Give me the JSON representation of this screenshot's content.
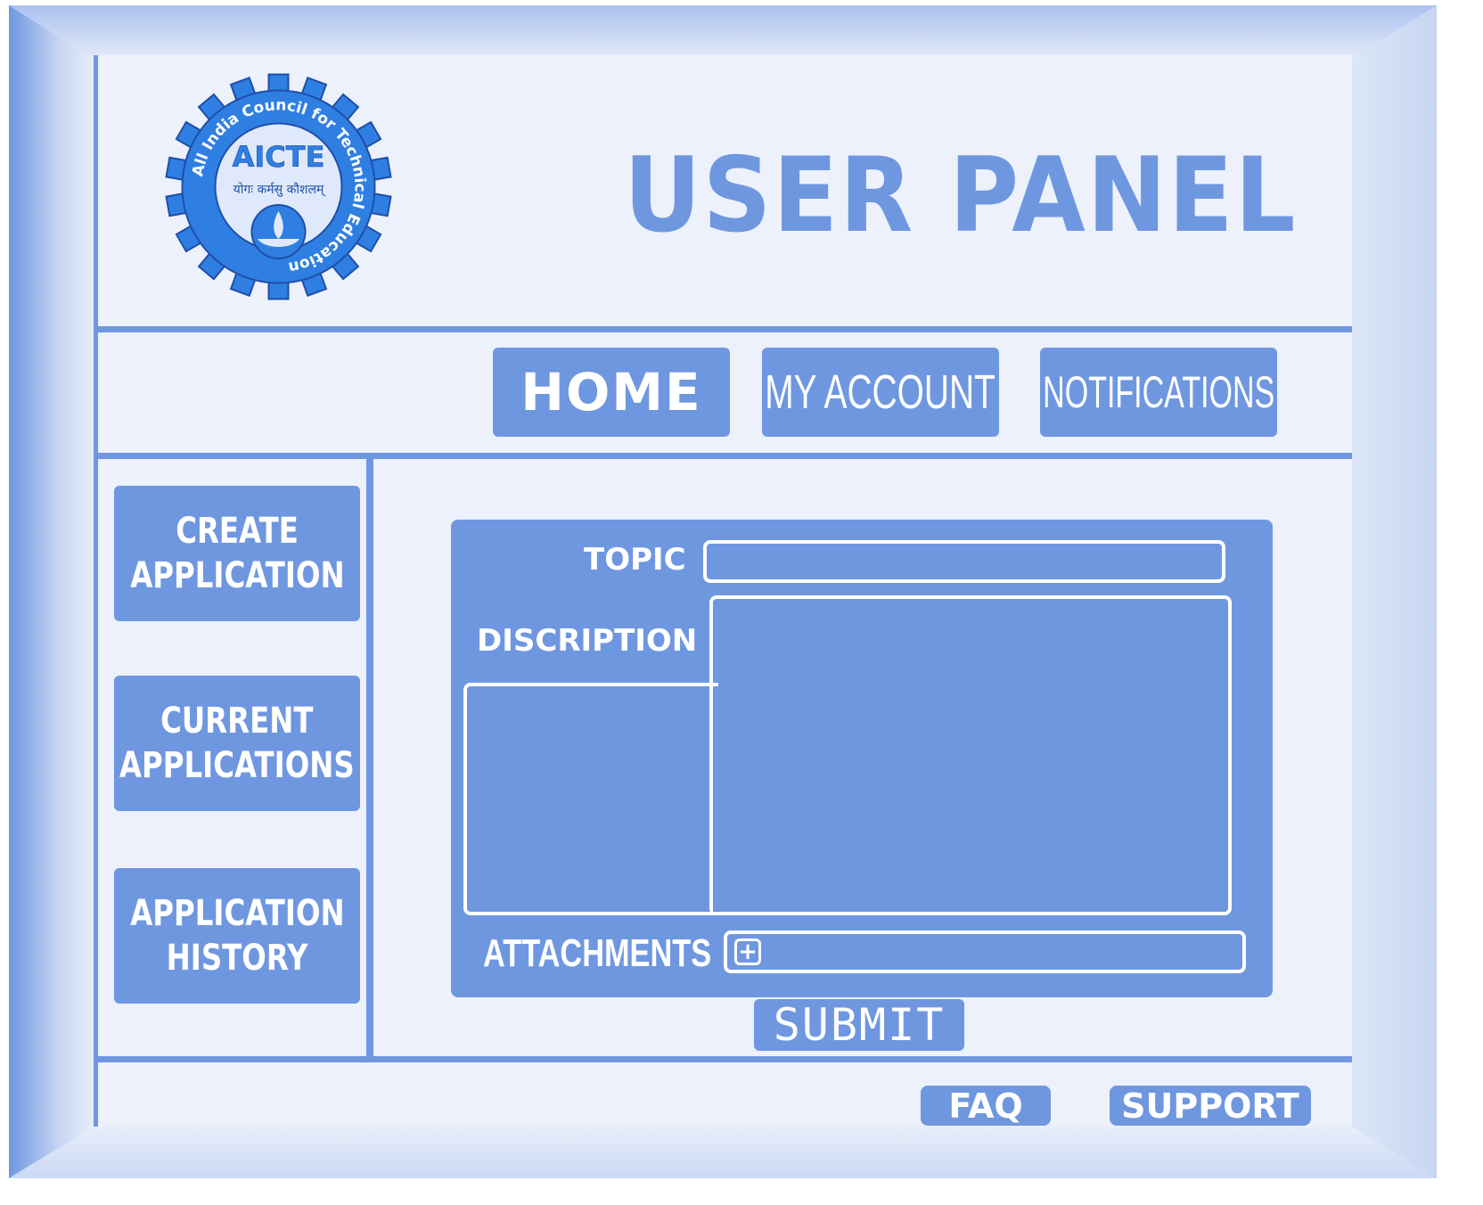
{
  "header": {
    "title": "USER PANEL",
    "logo": {
      "name": "AICTE",
      "ring_text": "All India Council for Technical Education",
      "motto": "योगः कर्मसु कौशलम्",
      "icon": "lamp-icon"
    }
  },
  "nav": {
    "home": "HOME",
    "account": "MY ACCOUNT",
    "notifications": "NOTIFICATIONS"
  },
  "sidebar": {
    "items": [
      {
        "line1": "CREATE",
        "line2": "APPLICATION"
      },
      {
        "line1": "CURRENT",
        "line2": "APPLICATIONS"
      },
      {
        "line1": "APPLICATION",
        "line2": "HISTORY"
      }
    ]
  },
  "form": {
    "topic_label": "TOPIC",
    "topic_value": "",
    "description_label": "DISCRIPTION",
    "description_value": "",
    "attachments_label": "ATTACHMENTS",
    "attach_icon": "plus-icon",
    "submit_label": "SUBMIT"
  },
  "footer": {
    "faq": "FAQ",
    "support": "SUPPORT"
  },
  "colors": {
    "accent": "#6f97e0",
    "panel_bg": "#ecf1fb",
    "logo_blue": "#2f7fe3",
    "logo_dark": "#1f4fa8",
    "text_on_accent": "#ffffff"
  }
}
